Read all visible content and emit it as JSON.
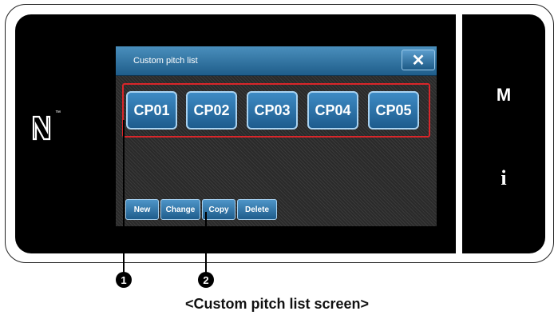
{
  "panel": {
    "title": "Custom pitch list",
    "close_icon": "close-icon",
    "pitches": [
      "CP01",
      "CP02",
      "CP03",
      "CP04",
      "CP05"
    ],
    "actions": [
      "New",
      "Change",
      "Copy",
      "Delete"
    ]
  },
  "side": {
    "m_label": "M",
    "i_label": "i",
    "tm": "™"
  },
  "callouts": [
    "1",
    "2"
  ],
  "caption": "<Custom pitch list screen>",
  "colors": {
    "highlight": "#d9262a",
    "button": "#2a6fa5",
    "background": "#000000"
  }
}
